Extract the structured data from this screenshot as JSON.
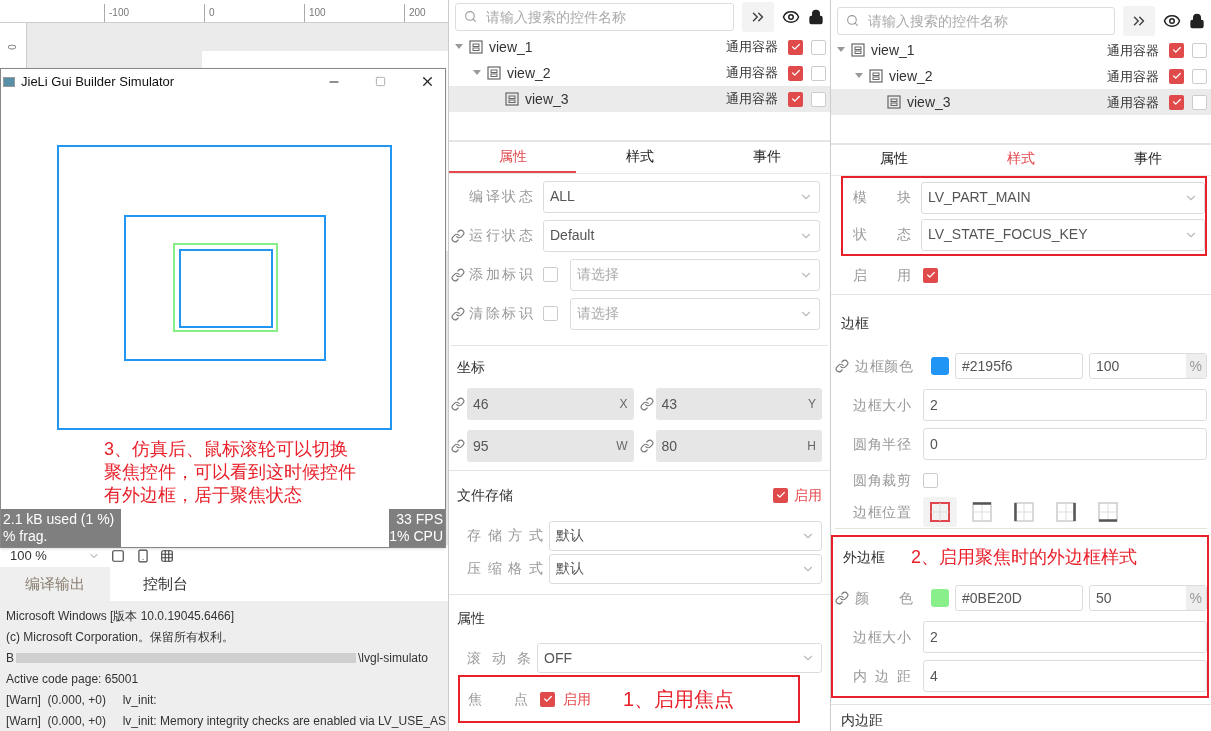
{
  "editor": {
    "ruler_labels": [
      "-100",
      "0",
      "100",
      "200"
    ],
    "vertical_ruler_label": "0",
    "zoom": "100 %"
  },
  "simulator": {
    "title": "JieLi Gui Builder Simulator",
    "annotation": [
      "3、仿真后、鼠标滚轮可以切换",
      "聚焦控件，可以看到这时候控件",
      "有外边框，居于聚焦状态"
    ],
    "memory": [
      "2.1 kB used (1 %)",
      "% frag."
    ],
    "performance": [
      "33 FPS",
      "1% CPU"
    ]
  },
  "output": {
    "tabs": [
      {
        "label": "编译输出",
        "selected": false
      },
      {
        "label": "控制台",
        "selected": true
      }
    ],
    "lines": [
      {
        "kind": "text",
        "text": "Microsoft Windows [版本 10.0.19045.6466]"
      },
      {
        "kind": "text",
        "text": "(c) Microsoft Corporation。保留所有权利。"
      },
      {
        "kind": "blurred",
        "prefix": "B",
        "text": "\\lvgl-simulato"
      },
      {
        "kind": "text",
        "text": "Active code page: 65001"
      },
      {
        "kind": "log",
        "level": "[Warn]",
        "time": "(0.000, +0)",
        "text": "lv_init:"
      },
      {
        "kind": "log",
        "level": "[Warn]",
        "time": "(0.000, +0)",
        "text": "lv_init: Memory integrity checks are enabled via LV_USE_AS"
      }
    ]
  },
  "properties_panel": {
    "search": {
      "placeholder": "请输入搜索的控件名称"
    },
    "tree": [
      {
        "name": "view_1",
        "type": "通用容器",
        "visible": true,
        "locked": false,
        "selected": false,
        "expanded": true,
        "children": [
          {
            "name": "view_2",
            "type": "通用容器",
            "visible": true,
            "locked": false,
            "selected": false,
            "expanded": true,
            "children": [
              {
                "name": "view_3",
                "type": "通用容器",
                "visible": true,
                "locked": false,
                "selected": true
              }
            ]
          }
        ]
      }
    ],
    "tabs": [
      {
        "label": "属性",
        "selected": true
      },
      {
        "label": "样式",
        "selected": false
      },
      {
        "label": "事件",
        "selected": false
      }
    ],
    "fields": [
      {
        "kind": "select",
        "label": "编译状态",
        "linked": false,
        "value": "ALL"
      },
      {
        "kind": "select",
        "label": "运行状态",
        "linked": true,
        "value": "Default"
      },
      {
        "kind": "check-select",
        "label": "添加标识",
        "linked": true,
        "checked": false,
        "placeholder": "请选择"
      },
      {
        "kind": "check-select",
        "label": "清除标识",
        "linked": true,
        "checked": false,
        "placeholder": "请选择"
      }
    ],
    "coords": {
      "title": "坐标",
      "items": [
        {
          "value": "46",
          "unit": "X"
        },
        {
          "value": "43",
          "unit": "Y"
        },
        {
          "value": "95",
          "unit": "W"
        },
        {
          "value": "80",
          "unit": "H"
        }
      ]
    },
    "file_storage": {
      "title": "文件存储",
      "enabled": true,
      "enabled_label": "启用",
      "fields": [
        {
          "label": "存储方式",
          "value": "默认"
        },
        {
          "label": "压缩格式",
          "value": "默认"
        }
      ]
    },
    "attributes": {
      "title": "属性",
      "scrollbar": {
        "label": "滚动条",
        "value": "OFF"
      },
      "focus": {
        "label": "焦点",
        "checked": true,
        "text": "启用"
      },
      "annotation": "1、启用焦点"
    }
  },
  "style_panel": {
    "search": {
      "placeholder": "请输入搜索的控件名称"
    },
    "tree": [
      {
        "name": "view_1",
        "type": "通用容器",
        "visible": true,
        "locked": false,
        "selected": false,
        "expanded": true,
        "children": [
          {
            "name": "view_2",
            "type": "通用容器",
            "visible": true,
            "locked": false,
            "selected": false,
            "expanded": true,
            "children": [
              {
                "name": "view_3",
                "type": "通用容器",
                "visible": true,
                "locked": false,
                "selected": true
              }
            ]
          }
        ]
      }
    ],
    "tabs": [
      {
        "label": "属性",
        "selected": false
      },
      {
        "label": "样式",
        "selected": true
      },
      {
        "label": "事件",
        "selected": false
      }
    ],
    "part": {
      "label": "模块",
      "value": "LV_PART_MAIN"
    },
    "state": {
      "label": "状态",
      "value": "LV_STATE_FOCUS_KEY"
    },
    "enabled": {
      "label": "启用",
      "checked": true
    },
    "border": {
      "title": "边框",
      "color": {
        "label": "边框颜色",
        "color": "#2195f6",
        "hex": "#2195f6",
        "opacity": "100",
        "unit": "%"
      },
      "width": {
        "label": "边框大小",
        "value": "2"
      },
      "radius": {
        "label": "圆角半径",
        "value": "0"
      },
      "clip": {
        "label": "圆角裁剪",
        "checked": false
      },
      "side": {
        "label": "边框位置",
        "options": [
          {
            "kind": "full",
            "selected": true
          },
          {
            "kind": "top",
            "selected": false
          },
          {
            "kind": "left",
            "selected": false
          },
          {
            "kind": "right",
            "selected": false
          },
          {
            "kind": "bottom",
            "selected": false
          }
        ]
      }
    },
    "outline": {
      "title": "外边框",
      "annotation": "2、启用聚焦时的外边框样式",
      "color": {
        "label": "颜色",
        "color": "#88ef8a",
        "hex": "#0BE20D",
        "opacity": "50",
        "unit": "%"
      },
      "width": {
        "label": "边框大小",
        "value": "2"
      },
      "pad": {
        "label": "内边距",
        "value": "4"
      }
    },
    "next_section": "内边距"
  }
}
